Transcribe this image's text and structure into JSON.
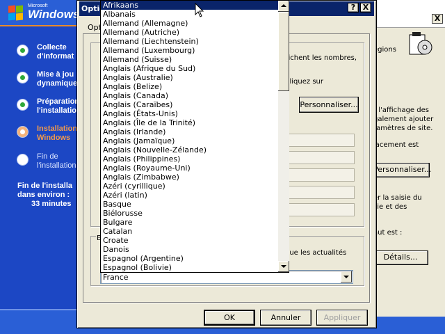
{
  "setup": {
    "logo": {
      "microsoft": "Microsoft",
      "brand": "Windows"
    },
    "steps": [
      {
        "line1": "Collecte",
        "line2": "d'informat",
        "state": "done"
      },
      {
        "line1": "Mise à jou",
        "line2": "dynamique",
        "state": "done"
      },
      {
        "line1": "Préparation",
        "line2": "l'installation",
        "state": "done"
      },
      {
        "line1": "Installation",
        "line2": "Windows",
        "state": "current"
      },
      {
        "line1": "Fin de",
        "line2": "l'installation",
        "state": "pending"
      }
    ],
    "remaining": {
      "line1": "Fin de l'installa",
      "line2": "dans environ :",
      "line3": "33 minutes"
    }
  },
  "back_dialog": {
    "close_label": "X",
    "regions_text": "égions",
    "texts": {
      "t1": "r l'affichage des",
      "t2": "galement ajouter",
      "t3": "ramètres de site.",
      "t4": "lacement est",
      "t5": "er la saisie du",
      "t6": "sie et des",
      "t7": "aut est :"
    },
    "customize_label": "Personnaliser...",
    "details_label": "Détails..."
  },
  "dialog": {
    "title": "Optio",
    "tab_label": "Opt",
    "help_label": "?",
    "close_label": "X",
    "text_numbers": "fichent les nombres,",
    "text_click": "cliquez sur",
    "customize_label": "Personnaliser...",
    "text_news": "que les actualités",
    "combo_value": "France",
    "ok_label": "OK",
    "cancel_label": "Annuler",
    "apply_label": "Appliquer",
    "group_letter": "E"
  },
  "droplist": {
    "selected_index": 0,
    "items": [
      "Afrikaans",
      "Albanais",
      "Allemand (Allemagne)",
      "Allemand (Autriche)",
      "Allemand (Liechtenstein)",
      "Allemand (Luxembourg)",
      "Allemand (Suisse)",
      "Anglais (Afrique du Sud)",
      "Anglais (Australie)",
      "Anglais (Belize)",
      "Anglais (Canada)",
      "Anglais (Caraïbes)",
      "Anglais (États-Unis)",
      "Anglais (Île de la Trinité)",
      "Anglais (Irlande)",
      "Anglais (Jamaïque)",
      "Anglais (Nouvelle-Zélande)",
      "Anglais (Philippines)",
      "Anglais (Royaume-Uni)",
      "Anglais (Zimbabwe)",
      "Azéri (cyrillique)",
      "Azéri (latin)",
      "Basque",
      "Biélorusse",
      "Bulgare",
      "Catalan",
      "Croate",
      "Danois",
      "Espagnol (Argentine)",
      "Espagnol (Bolivie)"
    ]
  },
  "colors": {
    "setup_blue": "#1c47c4",
    "title_bar": "#0a246a",
    "selection": "#0a246a",
    "step_done": "#2fa83a",
    "step_current": "#f39a4a"
  }
}
